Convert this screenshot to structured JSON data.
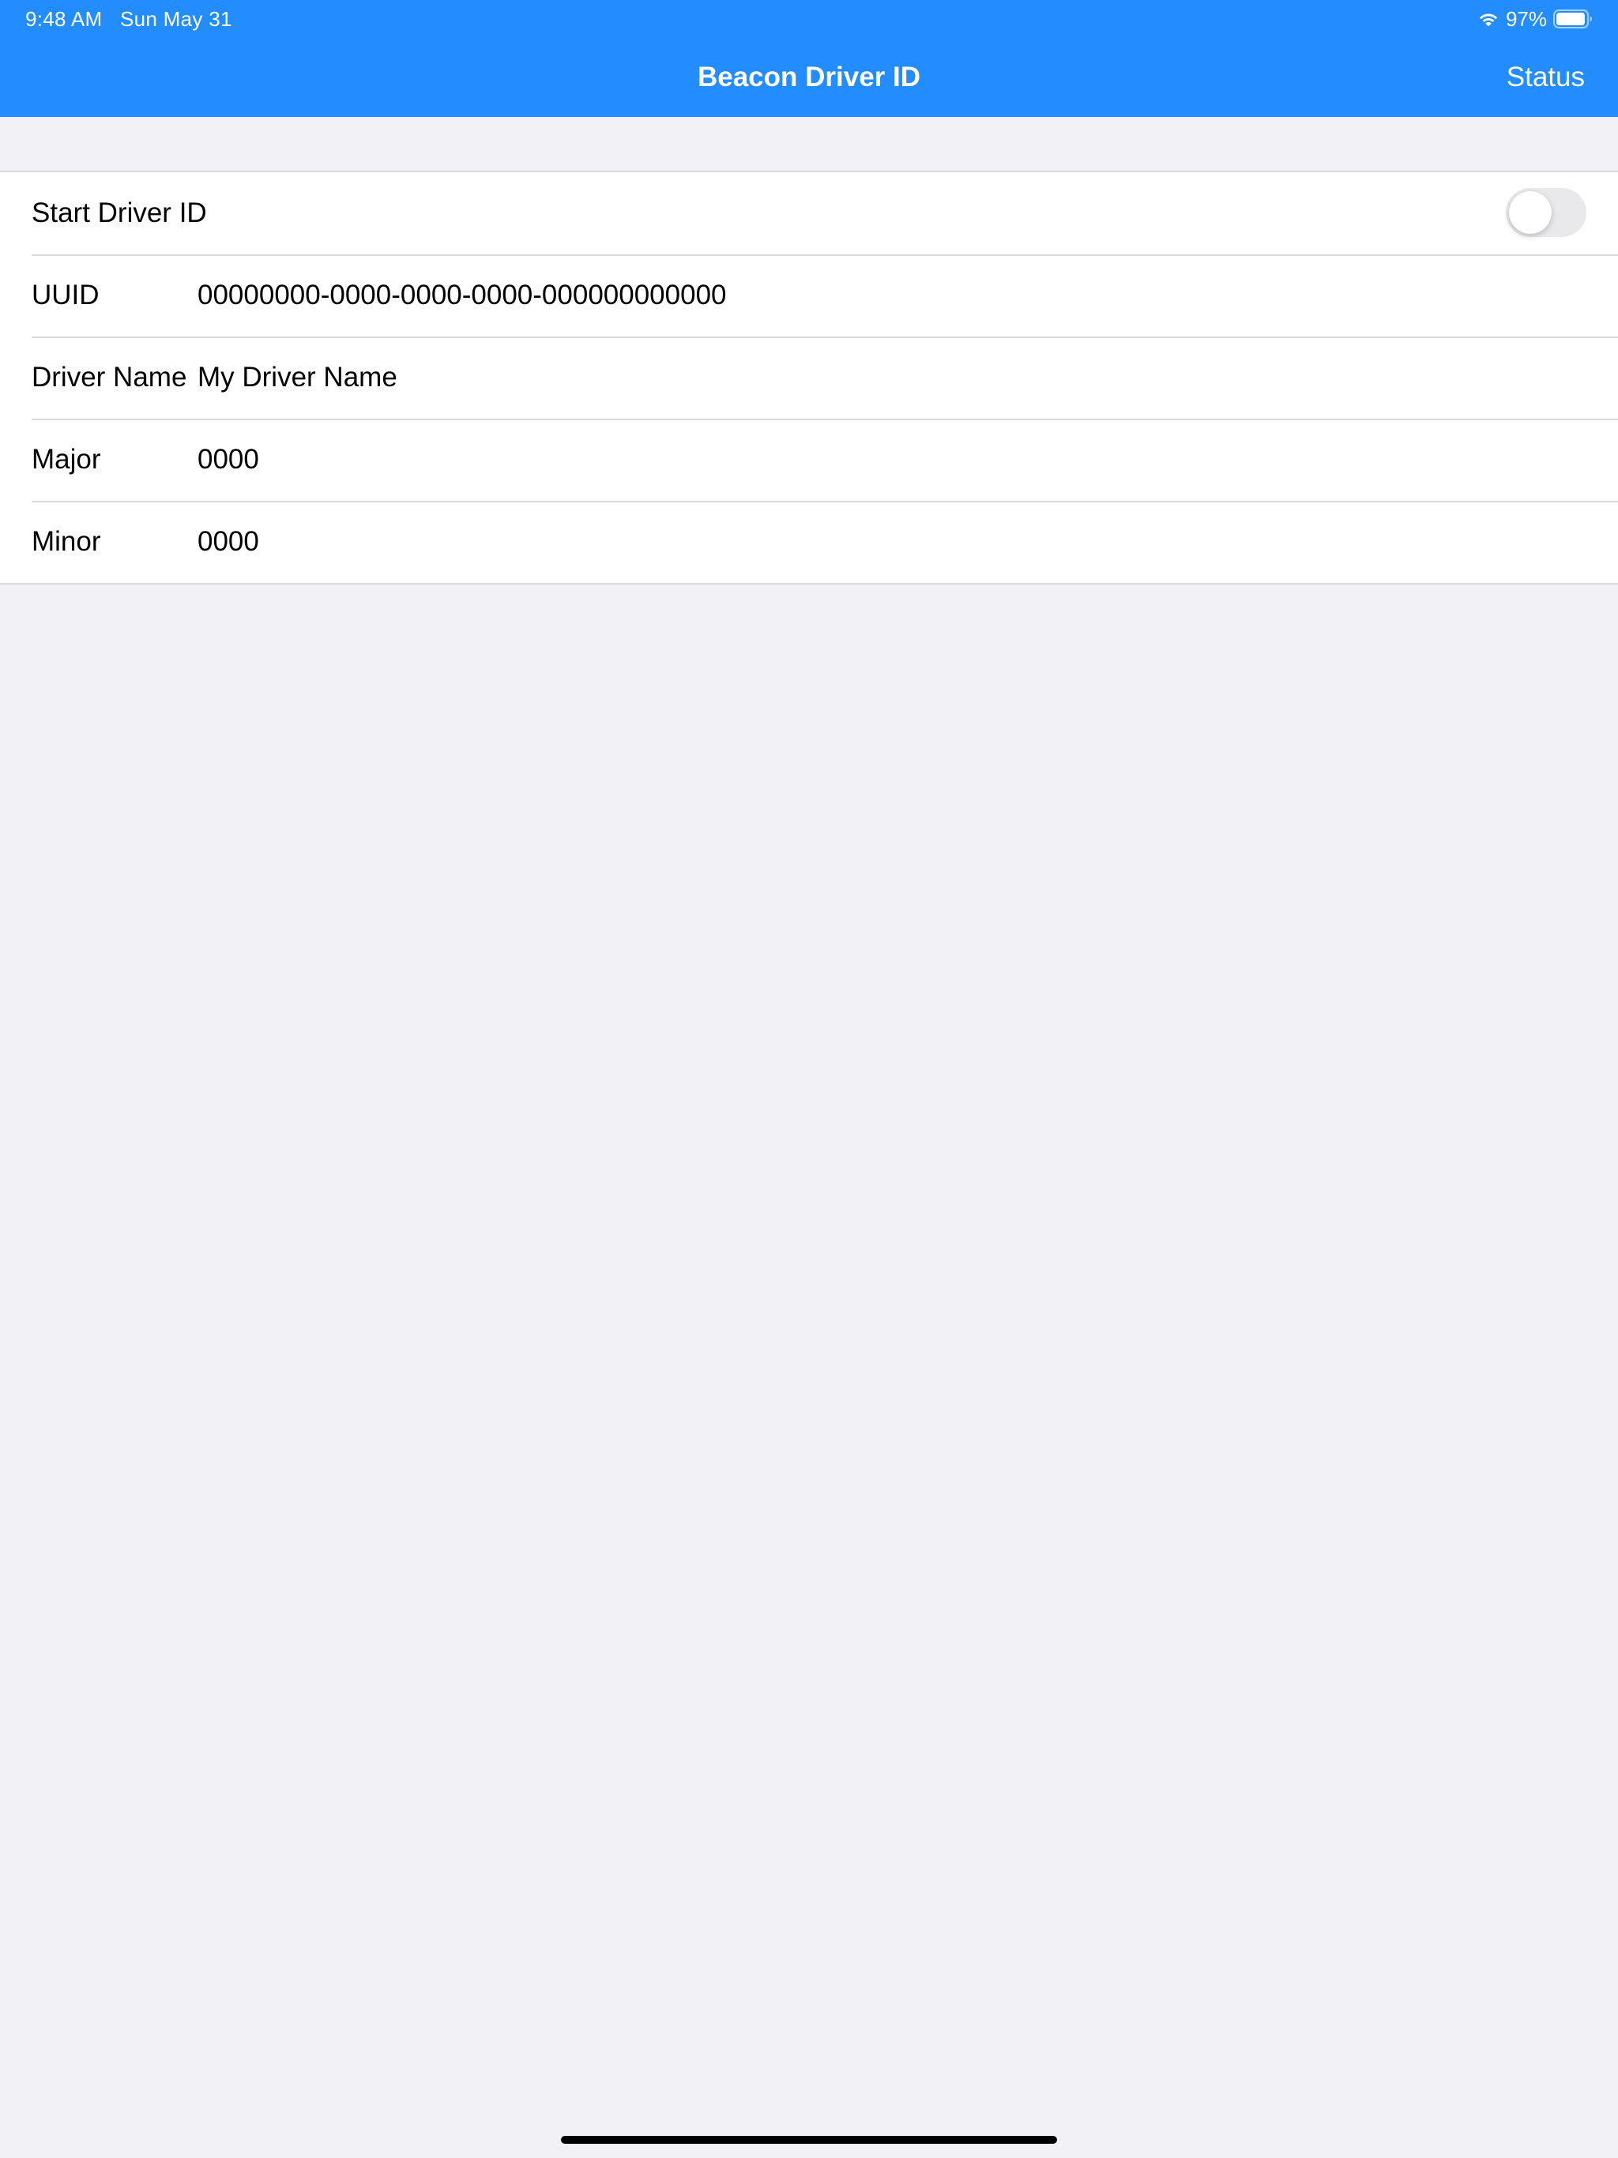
{
  "status_bar": {
    "time": "9:48 AM",
    "date": "Sun May 31",
    "battery_percent": "97%",
    "battery_level": 0.97,
    "icons": [
      "wifi-icon",
      "battery-icon"
    ]
  },
  "nav": {
    "title": "Beacon Driver ID",
    "right_button": "Status"
  },
  "form": {
    "start_label": "Start Driver ID",
    "start_enabled": false,
    "fields": [
      {
        "label": "UUID",
        "value": "00000000-0000-0000-0000-000000000000"
      },
      {
        "label": "Driver Name",
        "value": "My Driver Name"
      },
      {
        "label": "Major",
        "value": "0000"
      },
      {
        "label": "Minor",
        "value": "0000"
      }
    ]
  },
  "colors": {
    "accent": "#238cff",
    "background": "#f1f1f6",
    "separator": "#d9d9de",
    "toggle_off": "#e9e9eb"
  }
}
